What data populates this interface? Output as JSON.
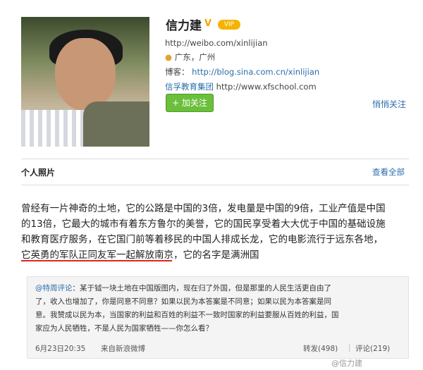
{
  "profile": {
    "name": "信力建",
    "verified_mark": "V",
    "vip_badge": "VIP",
    "weibo_url": "http://weibo.com/xinlijian",
    "location": "广东，广州",
    "blog_label": "博客：",
    "blog_url": "http://blog.sina.com.cn/xinlijian",
    "org_label": "信孚教育集团",
    "org_url": "http://www.xfschool.com",
    "follow_label": "+ 加关注",
    "quiet_follow_label": "悄悄关注"
  },
  "photos": {
    "title": "个人照片",
    "view_all": "查看全部"
  },
  "post": {
    "line1": "曾经有一片神奇的土地，它的公路是中国的3倍，发电量是中国的9倍，工业产值是中国",
    "line2": "的13倍，它最大的城市有着东方鲁尔的美誉，它的国民享受着大大优于中国的基础设施",
    "line3": "和教育医疗服务，在它国门前等着移民的中国人排成长龙，它的电影流行于远东各地，",
    "line4_underlined": "它英勇的军队正同友军一起解放南京，",
    "line4_rest": "它的名字是满洲国"
  },
  "repost": {
    "author": "@特周评论",
    "sep": "：",
    "line1": "某于钺一块土地在中国版图内，现在归了外国，但是那里的人民生活更自由了",
    "line2": "了，收入也增加了，你是同意不同意？如果以民为本答案是不同意；如果以民为本答案是同",
    "line3": "意。我赞成以民为本，当国家的利益和百姓的利益不一致时国家的利益要服从百姓的利益，国",
    "line4": "家应为人民牺牲，不是人民为国家牺牲——你怎么看？",
    "time": "6月23日20:35",
    "source": "来自新浪微博",
    "forward": "转发(498)",
    "sep_bar": "|",
    "comment": "评论(219)"
  },
  "watermark": "@信力建"
}
